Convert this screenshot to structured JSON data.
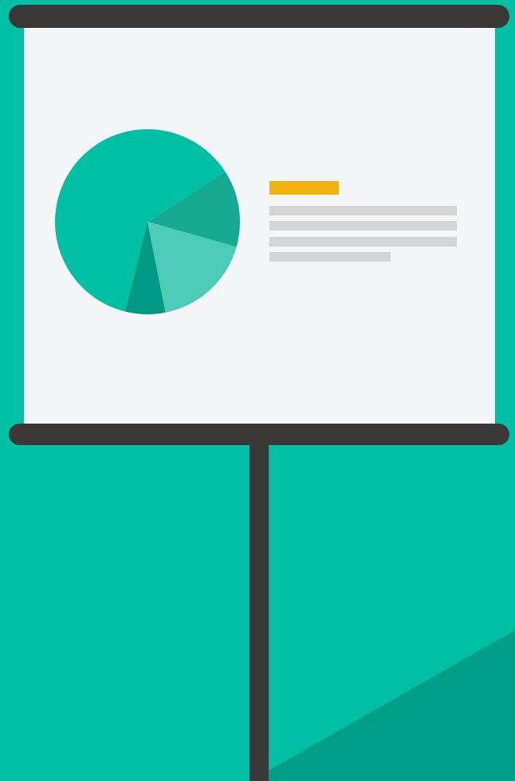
{
  "colors": {
    "background": "#00BFA5",
    "background_shadow": "#009E87",
    "screen": "#F4F5F7",
    "frame": "#3A3836",
    "pole": "#3A3836",
    "title_bar": "#F2B20F",
    "text_lines": "#D4D4D4"
  },
  "illustration": {
    "subject": "presentation-screen-with-pie-chart",
    "pie_slices": [
      {
        "share": 0.62,
        "color": "#00BFA5"
      },
      {
        "share": 0.135,
        "color": "#17AA93"
      },
      {
        "share": 0.175,
        "color": "#4DCAB8"
      },
      {
        "share": 0.07,
        "color": "#009984"
      }
    ],
    "text_block": {
      "title_placeholder_count": 1,
      "line_placeholder_count": 4
    }
  }
}
